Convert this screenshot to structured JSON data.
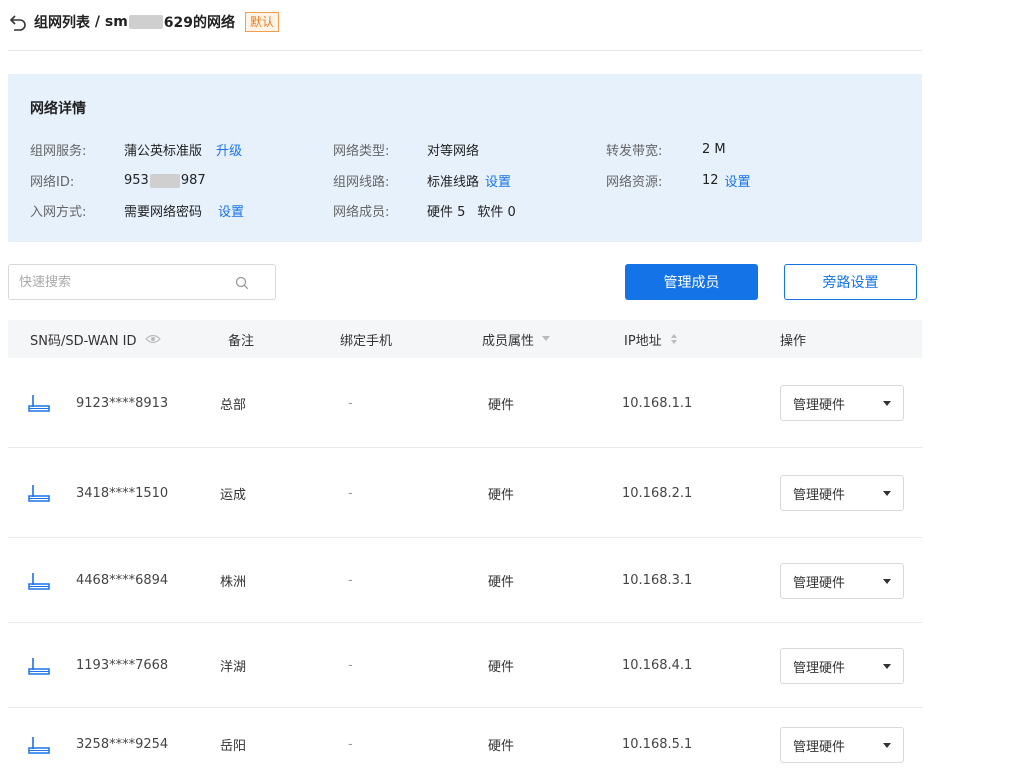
{
  "header": {
    "breadcrumb_parent": "组网列表",
    "separator": " / ",
    "network_name_prefix": "sm",
    "network_name_suffix": "629的网络",
    "default_badge": "默认"
  },
  "details": {
    "title": "网络详情",
    "service_label": "组网服务:",
    "service_value": "蒲公英标准版",
    "service_link": "升级",
    "network_type_label": "网络类型:",
    "network_type_value": "对等网络",
    "bandwidth_label": "转发带宽:",
    "bandwidth_value": "2 M",
    "network_id_label": "网络ID:",
    "network_id_prefix": "953",
    "network_id_suffix": "987",
    "line_label": "组网线路:",
    "line_value": "标准线路",
    "line_link": "设置",
    "resources_label": "网络资源:",
    "resources_value": "12",
    "resources_link": "设置",
    "join_label": "入网方式:",
    "join_value": "需要网络密码",
    "join_link": "设置",
    "members_label": "网络成员:",
    "members_hardware": "硬件 5",
    "members_software": "软件 0"
  },
  "search": {
    "placeholder": "快速搜索",
    "value": ""
  },
  "buttons": {
    "manage_members": "管理成员",
    "bypass_settings": "旁路设置"
  },
  "table": {
    "columns": {
      "sn": "SN码/SD-WAN ID",
      "note": "备注",
      "phone": "绑定手机",
      "attr": "成员属性",
      "ip": "IP地址",
      "action": "操作"
    },
    "rows": [
      {
        "sn": "9123****8913",
        "note": "总部",
        "phone": "-",
        "attr": "硬件",
        "ip": "10.168.1.1",
        "action": "管理硬件"
      },
      {
        "sn": "3418****1510",
        "note": "运成",
        "phone": "-",
        "attr": "硬件",
        "ip": "10.168.2.1",
        "action": "管理硬件"
      },
      {
        "sn": "4468****6894",
        "note": "株洲",
        "phone": "-",
        "attr": "硬件",
        "ip": "10.168.3.1",
        "action": "管理硬件"
      },
      {
        "sn": "1193****7668",
        "note": "洋湖",
        "phone": "-",
        "attr": "硬件",
        "ip": "10.168.4.1",
        "action": "管理硬件"
      },
      {
        "sn": "3258****9254",
        "note": "岳阳",
        "phone": "-",
        "attr": "硬件",
        "ip": "10.168.5.1",
        "action": "管理硬件"
      }
    ]
  },
  "colors": {
    "primary": "#1473e6",
    "panel_bg": "#e6f1fc",
    "badge": "#e67e22"
  },
  "icons": {
    "back": "back-arrow-icon",
    "search": "search-icon",
    "router": "router-icon",
    "eye": "eye-icon",
    "sort": "sort-icon",
    "filter": "filter-caret-icon"
  }
}
